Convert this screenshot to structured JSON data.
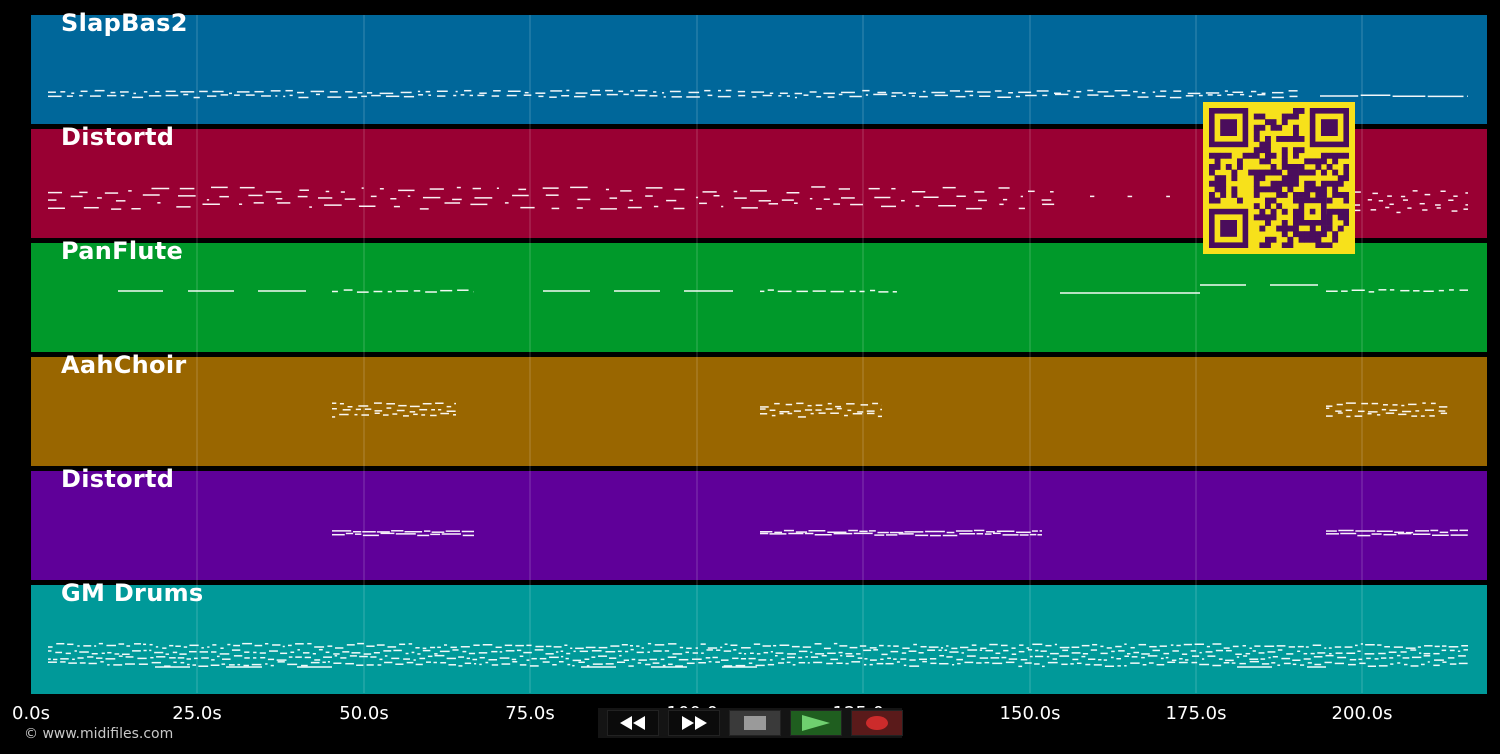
{
  "tracks": [
    {
      "name": "SlapBas2",
      "color": "#00679a"
    },
    {
      "name": "Distortd",
      "color": "#990033"
    },
    {
      "name": "PanFlute",
      "color": "#00992a"
    },
    {
      "name": "AahChoir",
      "color": "#996600"
    },
    {
      "name": "Distortd",
      "color": "#5f0099"
    },
    {
      "name": "GM Drums",
      "color": "#009999"
    }
  ],
  "timeline": {
    "ticks": [
      "0.0s",
      "25.0s",
      "50.0s",
      "75.0s",
      "100.0s",
      "125.0s",
      "150.0s",
      "175.0s",
      "200.0s"
    ]
  },
  "transport": {
    "rewind": "rewind-icon",
    "fast_forward": "fast-forward-icon",
    "stop": "stop-icon",
    "play": "play-icon",
    "record": "record-icon"
  },
  "copyright": "© www.midifiles.com",
  "qr_code": "qr-code"
}
